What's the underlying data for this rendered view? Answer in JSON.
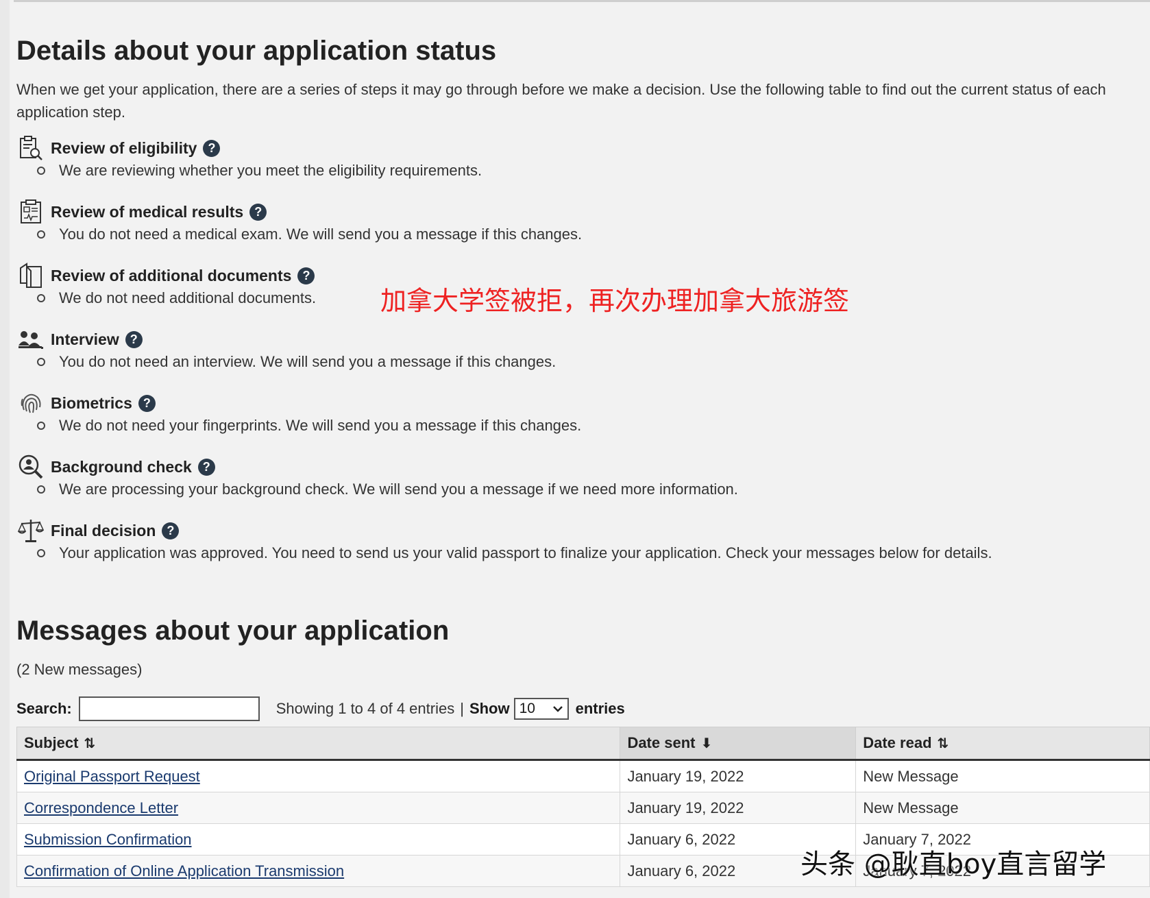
{
  "status": {
    "title": "Details about your application status",
    "intro": "When we get your application, there are a series of steps it may go through before we make a decision. Use the following table to find out the current status of each application step.",
    "help_glyph": "?",
    "steps": [
      {
        "title": "Review of eligibility",
        "desc": "We are reviewing whether you meet the eligibility requirements.",
        "icon": "clipboard-search-icon"
      },
      {
        "title": "Review of medical results",
        "desc": "You do not need a medical exam. We will send you a message if this changes.",
        "icon": "medical-report-icon"
      },
      {
        "title": "Review of additional documents",
        "desc": "We do not need additional documents.",
        "icon": "documents-icon"
      },
      {
        "title": "Interview",
        "desc": "You do not need an interview. We will send you a message if this changes.",
        "icon": "people-icon"
      },
      {
        "title": "Biometrics",
        "desc": "We do not need your fingerprints. We will send you a message if this changes.",
        "icon": "fingerprint-icon"
      },
      {
        "title": "Background check",
        "desc": "We are processing your background check. We will send you a message if we need more information.",
        "icon": "magnifier-person-icon"
      },
      {
        "title": "Final decision",
        "desc": "Your application was approved. You need to send us your valid passport to finalize your application. Check your messages below for details.",
        "icon": "scales-icon"
      }
    ]
  },
  "overlay_caption": "加拿大学签被拒，再次办理加拿大旅游签",
  "messages": {
    "title": "Messages about your application",
    "new_count": "(2 New messages)",
    "search_label": "Search:",
    "search_value": "",
    "showing": "Showing 1 to 4 of 4 entries",
    "separator": "|",
    "show_label": "Show",
    "page_size": "10",
    "entries_label": "entries",
    "columns": [
      "Subject",
      "Date sent",
      "Date read"
    ],
    "rows": [
      {
        "subject": "Original Passport Request",
        "sent": "January 19, 2022",
        "read": "New Message"
      },
      {
        "subject": "Correspondence Letter",
        "sent": "January 19, 2022",
        "read": "New Message"
      },
      {
        "subject": "Submission Confirmation",
        "sent": "January 6, 2022",
        "read": "January 7, 2022"
      },
      {
        "subject": "Confirmation of Online Application Transmission",
        "sent": "January 6, 2022",
        "read": "January 7, 2022"
      }
    ]
  },
  "watermark": "头条 @耿直boy直言留学"
}
